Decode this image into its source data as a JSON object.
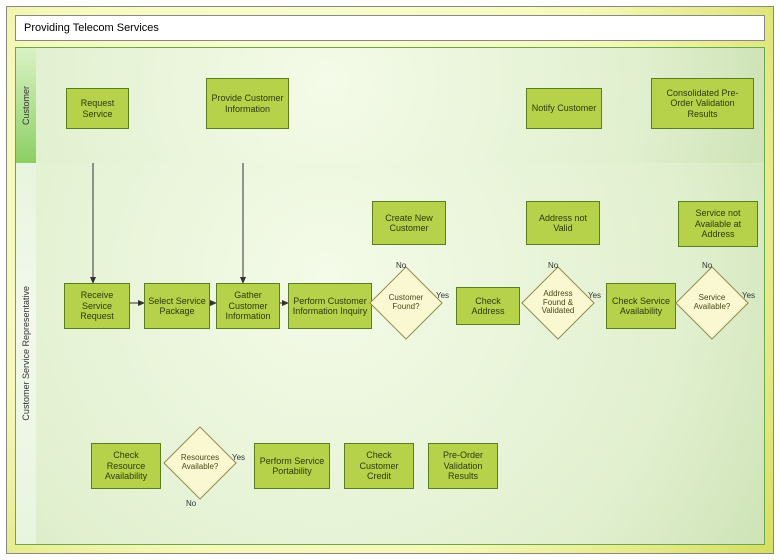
{
  "title": "Providing Telecom Services",
  "lanes": {
    "customer": "Customer",
    "csr": "Customer Service Representative"
  },
  "nodes": {
    "reqService": "Request Service",
    "provideInfo": "Provide Customer Information",
    "notify": "Notify Customer",
    "consResults": "Consolidated Pre-Order Validation Results",
    "receiveReq": "Receive Service Request",
    "selectPkg": "Select Service Package",
    "gatherInfo": "Gather Customer Information",
    "performInq": "Perform Customer Information Inquiry",
    "createCust": "Create New Customer",
    "custFound": "Customer Found?",
    "checkAddr": "Check Address",
    "addrNotValid": "Address not Valid",
    "addrFound": "Address Found & Validated",
    "checkSvcAvail": "Check Service Availability",
    "svcNotAvail": "Service not Available at Address",
    "svcAvail": "Service Available?",
    "checkRes": "Check Resource Availability",
    "resAvail": "Resources Available?",
    "perfPort": "Perform Service Portability",
    "checkCredit": "Check Customer Credit",
    "preOrder": "Pre-Order Validation Results"
  },
  "labels": {
    "yes": "Yes",
    "no": "No"
  }
}
